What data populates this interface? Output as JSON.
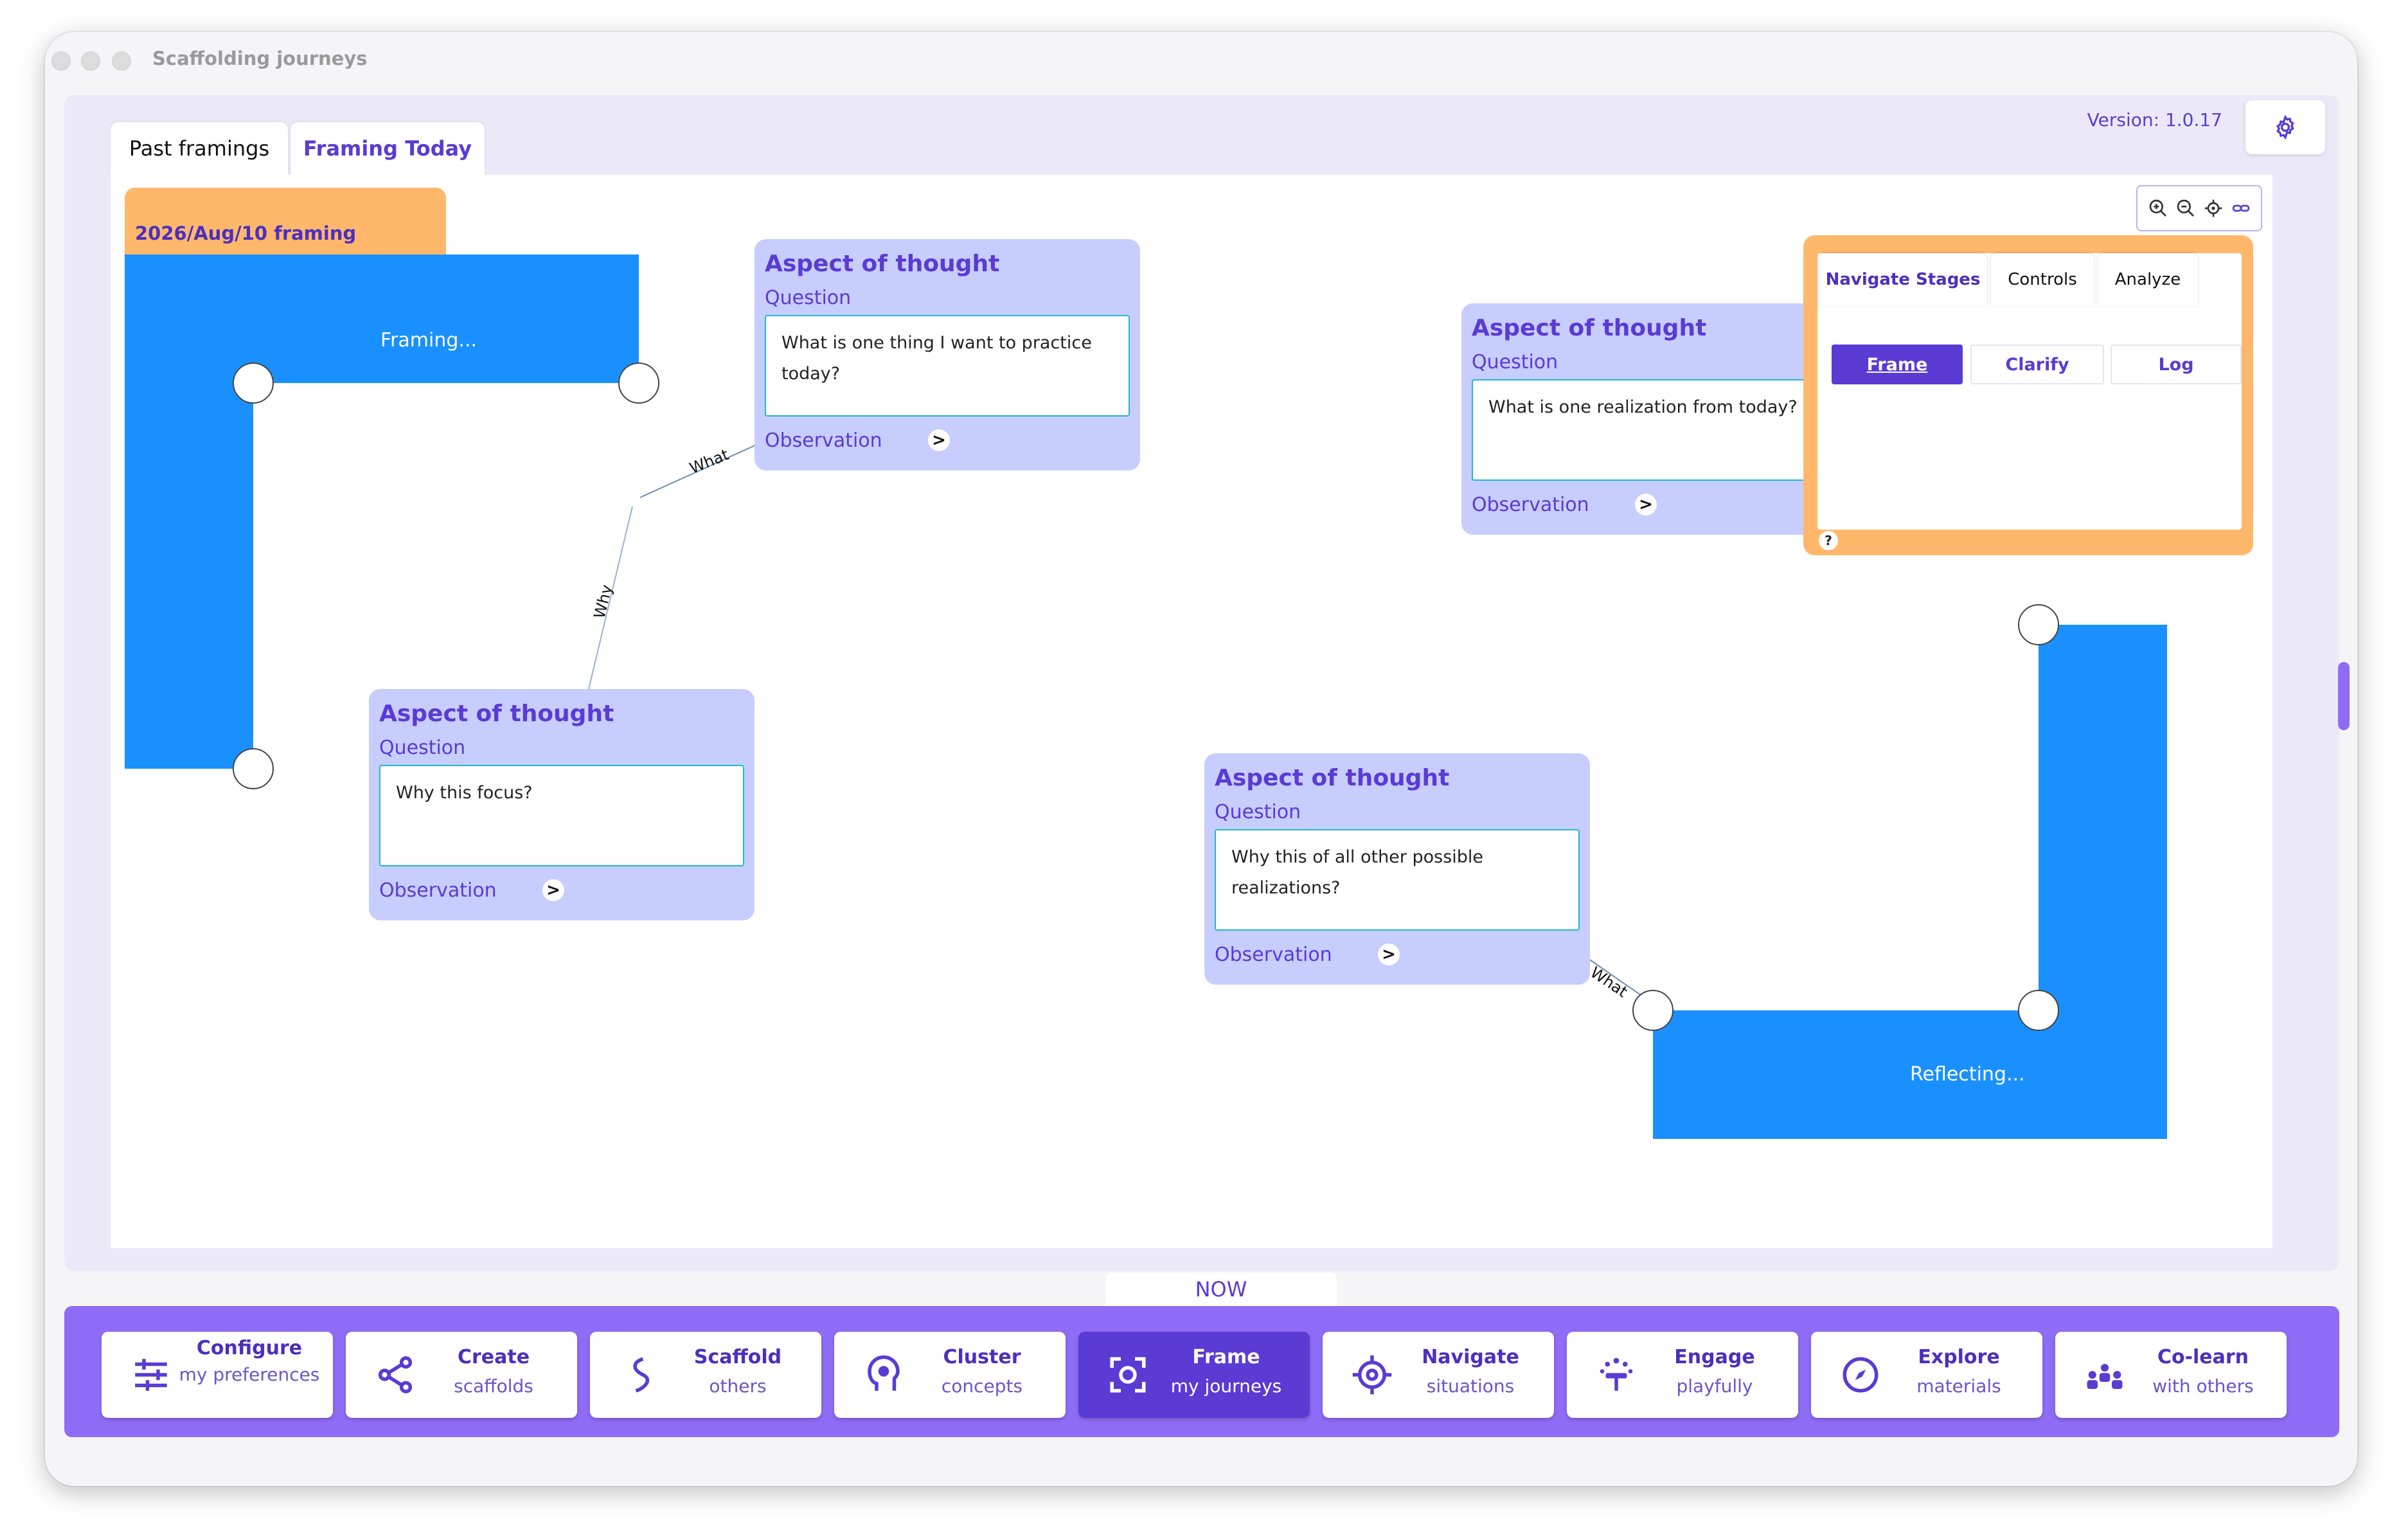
{
  "window": {
    "title": "Scaffolding journeys"
  },
  "header": {
    "tabs": [
      {
        "label": "Past framings",
        "active": false
      },
      {
        "label": "Framing Today",
        "active": true
      }
    ],
    "version": "Version: 1.0.17",
    "settings_icon": "gear-icon"
  },
  "canvas": {
    "date_card": {
      "label": "2026/Aug/10 framing",
      "button": ">"
    },
    "stages": [
      {
        "label": "Framing..."
      },
      {
        "label": "Reflecting..."
      }
    ],
    "edges": [
      "What",
      "Why",
      "What"
    ],
    "aspects": [
      {
        "title": "Aspect of thought",
        "question_label": "Question",
        "question": "What is one thing I want to practice today?",
        "observation": "Observation",
        "button": ">"
      },
      {
        "title": "Aspect of thought",
        "question_label": "Question",
        "question": "Why this focus?",
        "observation": "Observation",
        "button": ">"
      },
      {
        "title": "Aspect of thought",
        "question_label": "Question",
        "question": "What is one realization from today?",
        "observation": "Observation",
        "button": ">"
      },
      {
        "title": "Aspect of thought",
        "question_label": "Question",
        "question": "Why this of all other possible realizations?",
        "observation": "Observation",
        "button": ">"
      }
    ],
    "zoom_tools": [
      "zoom-in-icon",
      "zoom-out-icon",
      "target-icon",
      "link-icon"
    ]
  },
  "controls_panel": {
    "tabs": [
      "Navigate Stages",
      "Controls",
      "Analyze"
    ],
    "stage_buttons": [
      {
        "label": "Frame",
        "active": true
      },
      {
        "label": "Clarify",
        "active": false
      },
      {
        "label": "Log",
        "active": false
      }
    ],
    "help": "?"
  },
  "bottom_nav": {
    "now_label": "NOW",
    "items": [
      {
        "main": "Configure",
        "sub": "my preferences",
        "icon": "sliders-icon",
        "active": false
      },
      {
        "main": "Create",
        "sub": "scaffolds",
        "icon": "nodes-icon",
        "active": false
      },
      {
        "main": "Scaffold",
        "sub": "others",
        "icon": "path-icon",
        "active": false
      },
      {
        "main": "Cluster",
        "sub": "concepts",
        "icon": "head-icon",
        "active": false
      },
      {
        "main": "Frame",
        "sub": "my journeys",
        "icon": "focus-frame-icon",
        "active": true
      },
      {
        "main": "Navigate",
        "sub": "situations",
        "icon": "target-icon",
        "active": false
      },
      {
        "main": "Engage",
        "sub": "playfully",
        "icon": "sparkle-icon",
        "active": false
      },
      {
        "main": "Explore",
        "sub": "materials",
        "icon": "compass-icon",
        "active": false
      },
      {
        "main": "Co-learn",
        "sub": "with others",
        "icon": "group-icon",
        "active": false
      }
    ]
  },
  "colors": {
    "accent": "#5a3bd4",
    "stage_blue": "#1a90ff",
    "orange": "#ffb86b",
    "aspect_bg": "#c7cdfd",
    "nav_bg": "#8f6cf6"
  }
}
